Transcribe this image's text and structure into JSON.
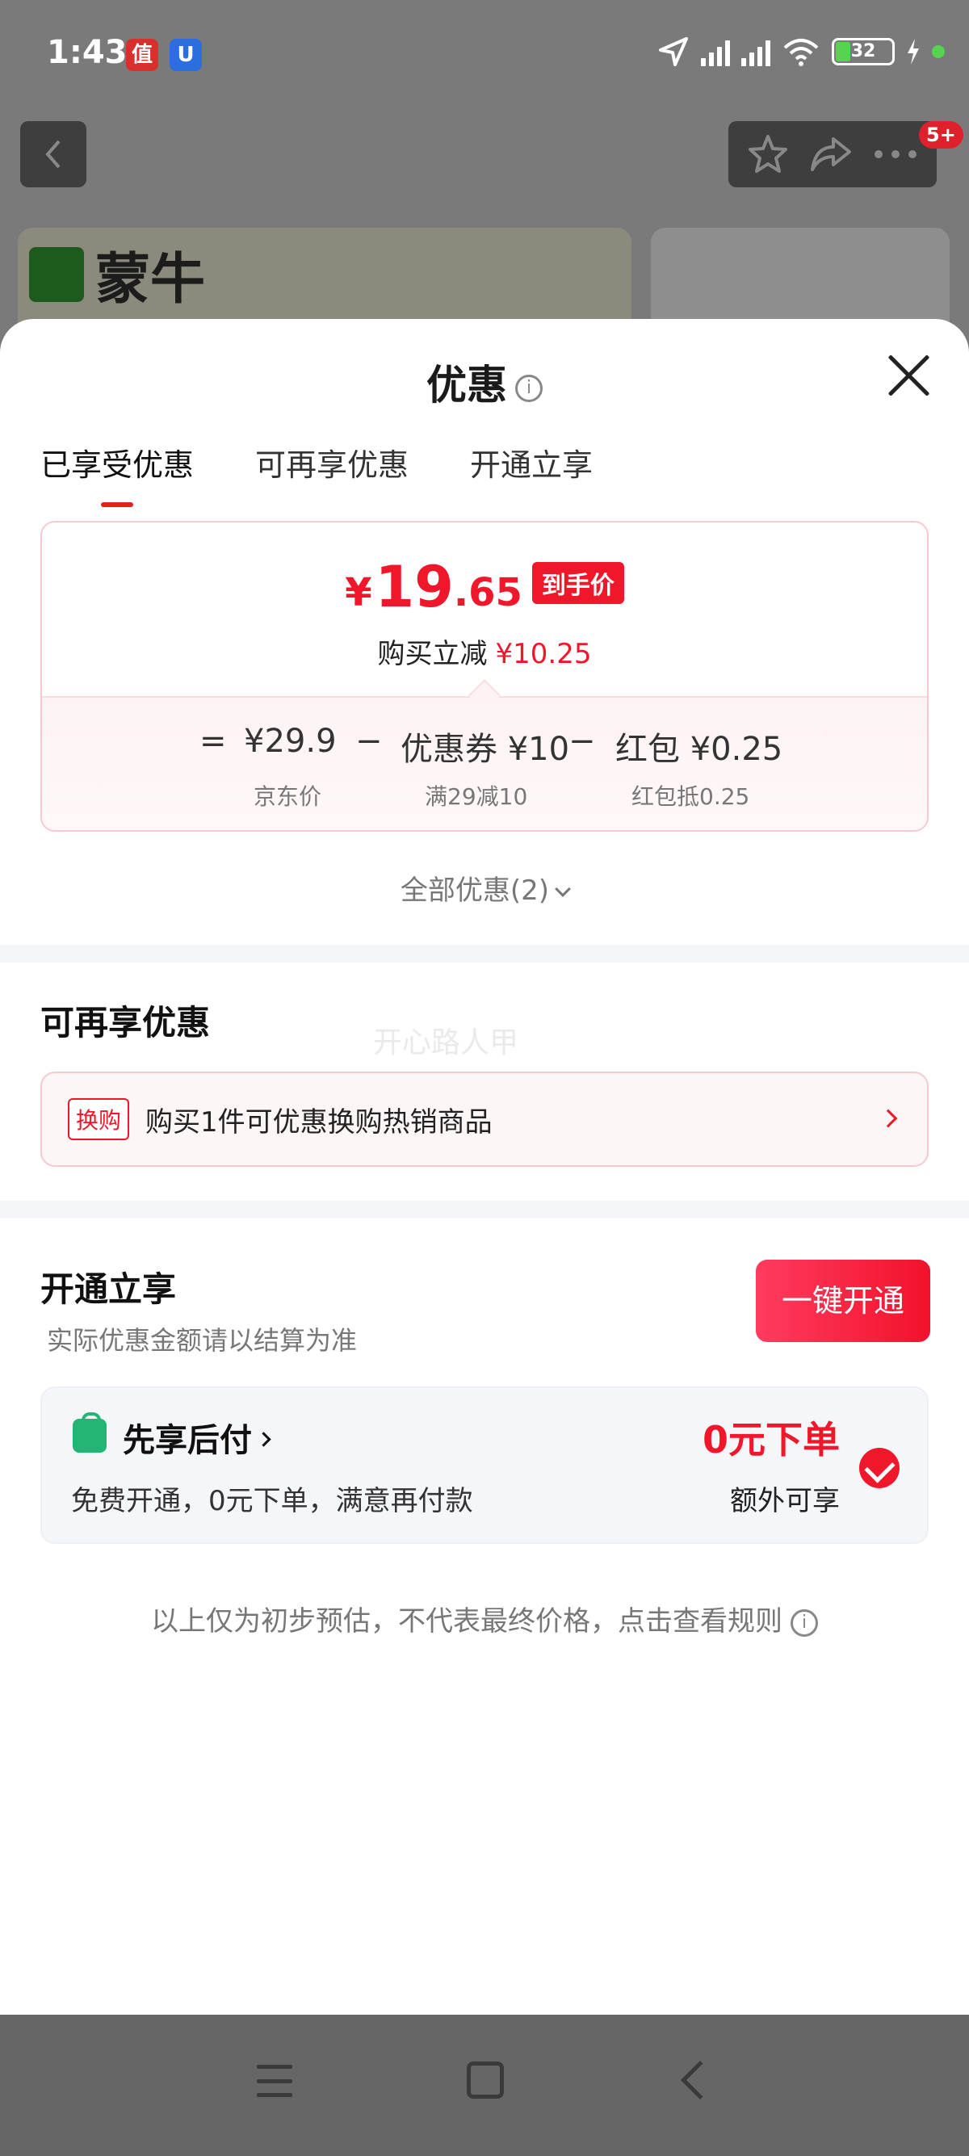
{
  "status": {
    "time": "1:43",
    "battery": "32",
    "app1_glyph": "值",
    "app2_glyph": "U"
  },
  "background": {
    "brand": "蒙牛",
    "badge": "5+"
  },
  "sheet": {
    "title": "优惠",
    "info_glyph": "i",
    "tabs": [
      {
        "label": "已享受优惠",
        "active": true
      },
      {
        "label": "可再享优惠",
        "active": false
      },
      {
        "label": "开通立享",
        "active": false
      }
    ],
    "price": {
      "currency": "¥",
      "int": "19",
      "dec": ".65",
      "tag": "到手价",
      "reduce_label": "购买立减",
      "reduce_amount": "¥10.25"
    },
    "calc": {
      "eq": "=",
      "minus": "−",
      "jd_price": "¥29.9",
      "jd_label": "京东价",
      "coupon": "优惠券 ¥10",
      "coupon_label": "满29减10",
      "redpacket": "红包 ¥0.25",
      "redpacket_label": "红包抵0.25"
    },
    "all_deals": "全部优惠(2)",
    "more_section": {
      "title": "可再享优惠",
      "watermark": "开心路人甲",
      "tag": "换购",
      "text": "购买1件可优惠换购热销商品"
    },
    "open_section": {
      "title": "开通立享",
      "note": "实际优惠金额请以结算为准",
      "button": "一键开通",
      "pay_title": "先享后付",
      "pay_desc": "免费开通，0元下单，满意再付款",
      "zero_num": "0",
      "zero_text": "元下单",
      "extra": "额外可享"
    },
    "disclaimer": "以上仅为初步预估，不代表最终价格，点击查看规则"
  },
  "colors": {
    "accent": "#f0172b",
    "green": "#22b573"
  }
}
